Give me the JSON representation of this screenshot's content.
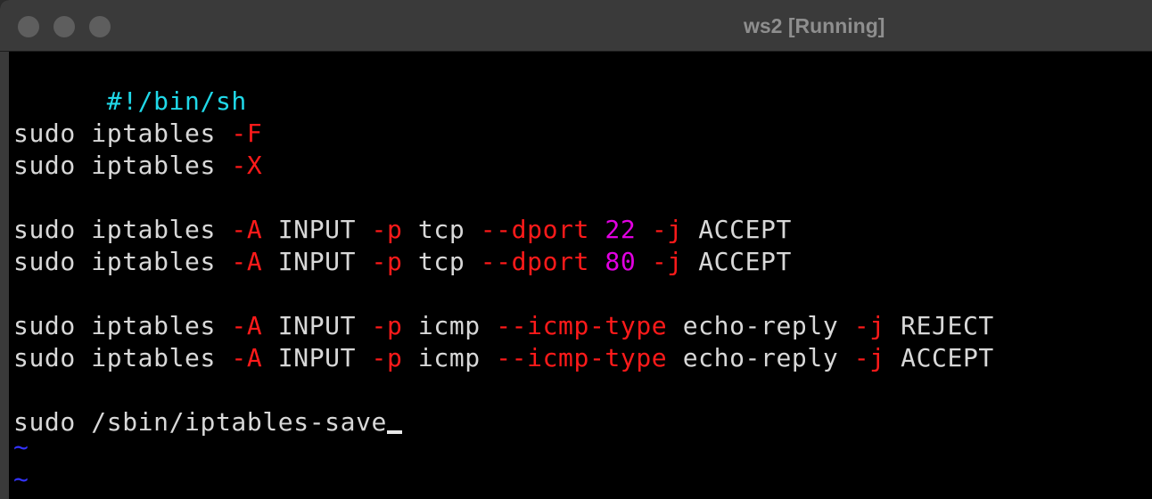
{
  "window": {
    "title": "ws2 [Running]"
  },
  "terminal": {
    "lines": [
      [
        "#!/bin/sh"
      ],
      [
        "sudo iptables ",
        "-F"
      ],
      [
        "sudo iptables ",
        "-X"
      ],
      [
        "sudo iptables ",
        "-A",
        " INPUT ",
        "-p",
        " tcp ",
        "--dport",
        " ",
        "22",
        " ",
        "-j",
        " ACCEPT"
      ],
      [
        "sudo iptables ",
        "-A",
        " INPUT ",
        "-p",
        " tcp ",
        "--dport",
        " ",
        "80",
        " ",
        "-j",
        " ACCEPT"
      ],
      [
        "sudo iptables ",
        "-A",
        " INPUT ",
        "-p",
        " icmp ",
        "--icmp-type",
        " echo-reply ",
        "-j",
        " REJECT"
      ],
      [
        "sudo iptables ",
        "-A",
        " INPUT ",
        "-p",
        " icmp ",
        "--icmp-type",
        " echo-reply ",
        "-j",
        " ACCEPT"
      ],
      [
        "sudo /sbin/iptables-save"
      ]
    ],
    "tilde": "~"
  },
  "colors": {
    "shebang": "#20d8e8",
    "flag": "#ff1a1a",
    "number": "#e100e1",
    "text": "#d8d8d8",
    "tilde": "#3333ff",
    "background": "#000000"
  }
}
